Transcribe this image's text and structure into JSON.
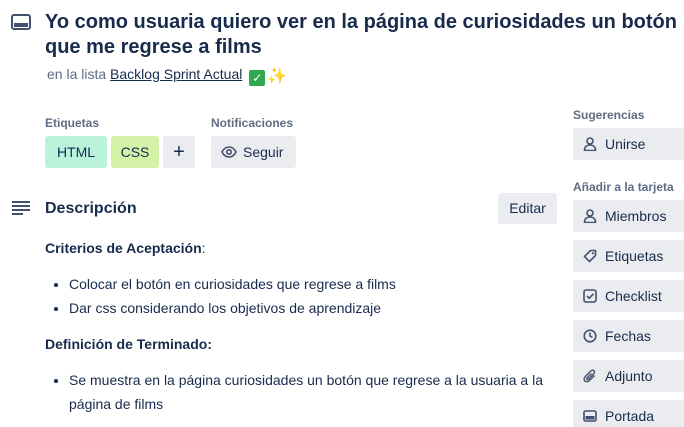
{
  "card": {
    "title": "Yo como usuaria quiero ver en la página de curiosidades un botón que me regrese a films",
    "list_prefix": "en la lista",
    "list_name": "Backlog Sprint Actual",
    "list_emojis": [
      "check-mark-emoji",
      "sparkles-emoji"
    ]
  },
  "labels": {
    "heading": "Etiquetas",
    "items": [
      {
        "text": "HTML",
        "color": "#baf3db"
      },
      {
        "text": "CSS",
        "color": "#d3f1a7"
      }
    ],
    "add_symbol": "+"
  },
  "notifications": {
    "heading": "Notificaciones",
    "follow_label": "Seguir"
  },
  "description": {
    "heading": "Descripción",
    "edit_label": "Editar",
    "criteria_title": "Criterios de Aceptación",
    "criteria_suffix": ":",
    "criteria": [
      "Colocar el botón en curiosidades que regrese a films",
      "Dar css considerando los objetivos de aprendizaje"
    ],
    "done_title": "Definición de Terminado:",
    "done": [
      "Se muestra en la página curiosidades un botón que regrese a la usuaria a la página de films"
    ]
  },
  "sidebar": {
    "suggestions_heading": "Sugerencias",
    "join_label": "Unirse",
    "add_heading": "Añadir a la tarjeta",
    "items": [
      {
        "label": "Miembros",
        "icon": "person-icon"
      },
      {
        "label": "Etiquetas",
        "icon": "label-tag-icon"
      },
      {
        "label": "Checklist",
        "icon": "checklist-icon"
      },
      {
        "label": "Fechas",
        "icon": "clock-icon"
      },
      {
        "label": "Adjunto",
        "icon": "paperclip-icon"
      },
      {
        "label": "Portada",
        "icon": "cover-icon"
      }
    ]
  },
  "colors": {
    "text": "#172b4d",
    "muted": "#5e6c84",
    "button_bg": "#ebecf0"
  }
}
